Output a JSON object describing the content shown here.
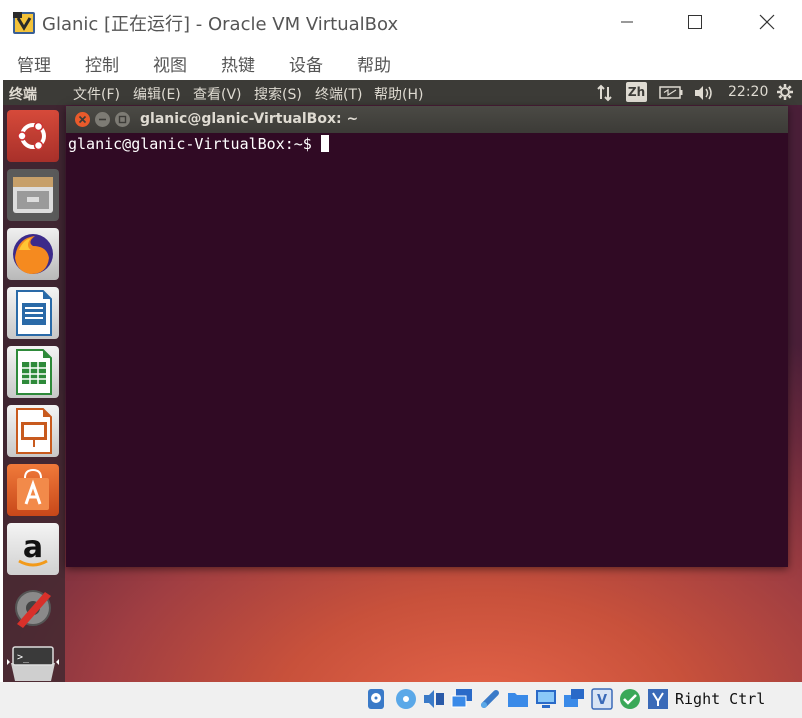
{
  "window": {
    "title": "Glanic [正在运行] - Oracle VM VirtualBox"
  },
  "menubar": {
    "items": [
      "管理",
      "控制",
      "视图",
      "热键",
      "设备",
      "帮助"
    ]
  },
  "guest": {
    "topbar": {
      "app_name": "终端",
      "menu": [
        "文件(F)",
        "编辑(E)",
        "查看(V)",
        "搜索(S)",
        "终端(T)",
        "帮助(H)"
      ],
      "input_method": "Zh",
      "clock": "22:20"
    },
    "launcher": [
      "ubuntu-dash-icon",
      "files-icon",
      "firefox-icon",
      "writer-icon",
      "calc-icon",
      "impress-icon",
      "software-center-icon",
      "amazon-icon",
      "system-settings-icon",
      "terminal-icon"
    ],
    "terminal": {
      "title": "glanic@glanic-VirtualBox: ~",
      "prompt": "glanic@glanic-VirtualBox:~$ "
    }
  },
  "statusbar": {
    "icons": [
      "hard-disk-icon",
      "optical-drive-icon",
      "audio-icon",
      "network-icon",
      "usb-icon",
      "shared-folders-icon",
      "display-icon",
      "screen-recording-icon",
      "virtualization-icon",
      "mouse-integration-icon",
      "keyboard-icon"
    ],
    "host_key": "Right Ctrl"
  }
}
